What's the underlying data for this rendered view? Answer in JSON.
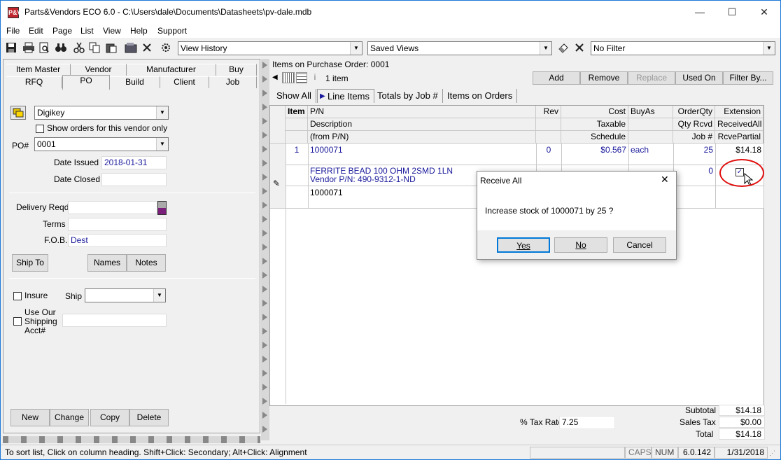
{
  "window": {
    "app_icon": "P&V",
    "title": "Parts&Vendors ECO 6.0 - C:\\Users\\dale\\Documents\\Datasheets\\pv-dale.mdb",
    "min": "—",
    "max": "☐",
    "close": "✕"
  },
  "menu": [
    "File",
    "Edit",
    "Page",
    "List",
    "View",
    "Help",
    "Support"
  ],
  "toolbar": {
    "history_combo": "View History",
    "saved_views": "Saved Views",
    "filter": "No Filter"
  },
  "left": {
    "tabs_top": [
      "Item Master",
      "Vendor",
      "Manufacturer",
      "Buy"
    ],
    "tabs_bottom": [
      "RFQ",
      "PO",
      "Build",
      "Client",
      "Job"
    ],
    "vendor": "Digikey",
    "show_orders_label": "Show orders for this vendor only",
    "po_label": "PO#",
    "po_value": "0001",
    "date_issued_label": "Date Issued",
    "date_issued": "2018-01-31",
    "date_closed_label": "Date Closed",
    "date_closed": "",
    "delivery_label": "Delivery Reqd",
    "terms_label": "Terms",
    "fob_label": "F.O.B.",
    "fob_value": "Dest",
    "ship_to": "Ship To",
    "names": "Names",
    "notes": "Notes",
    "insure_label": "Insure",
    "ship_label": "Ship",
    "use_our_label_1": "Use Our",
    "use_our_label_2": "Shipping",
    "use_our_label_3": "Acct#",
    "new": "New",
    "change": "Change",
    "copy": "Copy",
    "delete": "Delete"
  },
  "right": {
    "header": "Items on Purchase Order:  0001",
    "item_count": "1 item",
    "info_icon": "i",
    "buttons": [
      "Add",
      "Remove",
      "Replace",
      "Used On",
      "Filter By..."
    ],
    "subtabs": [
      "Show All",
      "Line Items",
      "Totals by Job #",
      "Items on Orders"
    ],
    "columns": {
      "item": "Item",
      "pn": "P/N",
      "rev": "Rev",
      "cost": "Cost",
      "buyas": "BuyAs",
      "orderqty": "OrderQty",
      "extension": "Extension",
      "description": "Description",
      "taxable": "Taxable",
      "qtyrcvd": "Qty Rcvd",
      "receivedall": "ReceivedAll",
      "from_pn": "(from P/N)",
      "schedule": "Schedule",
      "job": "Job #",
      "rcvepartial": "RcvePartial"
    },
    "row": {
      "item": "1",
      "pn": "1000071",
      "rev": "0",
      "cost": "$0.567",
      "buyas": "each",
      "orderqty": "25",
      "extension": "$14.18",
      "description": "FERRITE BEAD 100 OHM 2SMD 1LN",
      "vendor_pn": "Vendor P/N: 490-9312-1-ND",
      "qtyrcvd": "0",
      "from_pn": "1000071"
    },
    "tax_label": "% Tax Rate",
    "tax_rate": "7.25",
    "subtotal_label": "Subtotal",
    "subtotal": "$14.18",
    "sales_tax_label": "Sales Tax",
    "sales_tax": "$0.00",
    "total_label": "Total",
    "total": "$14.18"
  },
  "dialog": {
    "title": "Receive All",
    "message": "Increase stock of 1000071 by 25 ?",
    "yes": "Yes",
    "no": "No",
    "cancel": "Cancel"
  },
  "status": {
    "hint": "To sort list, Click on column heading. Shift+Click: Secondary; Alt+Click: Alignment",
    "caps": "CAPS",
    "num": "NUM",
    "version": "6.0.142",
    "date": "1/31/2018"
  },
  "colors": {
    "highlight_circle": "#e01010",
    "link_blue": "#1a1a9c"
  }
}
